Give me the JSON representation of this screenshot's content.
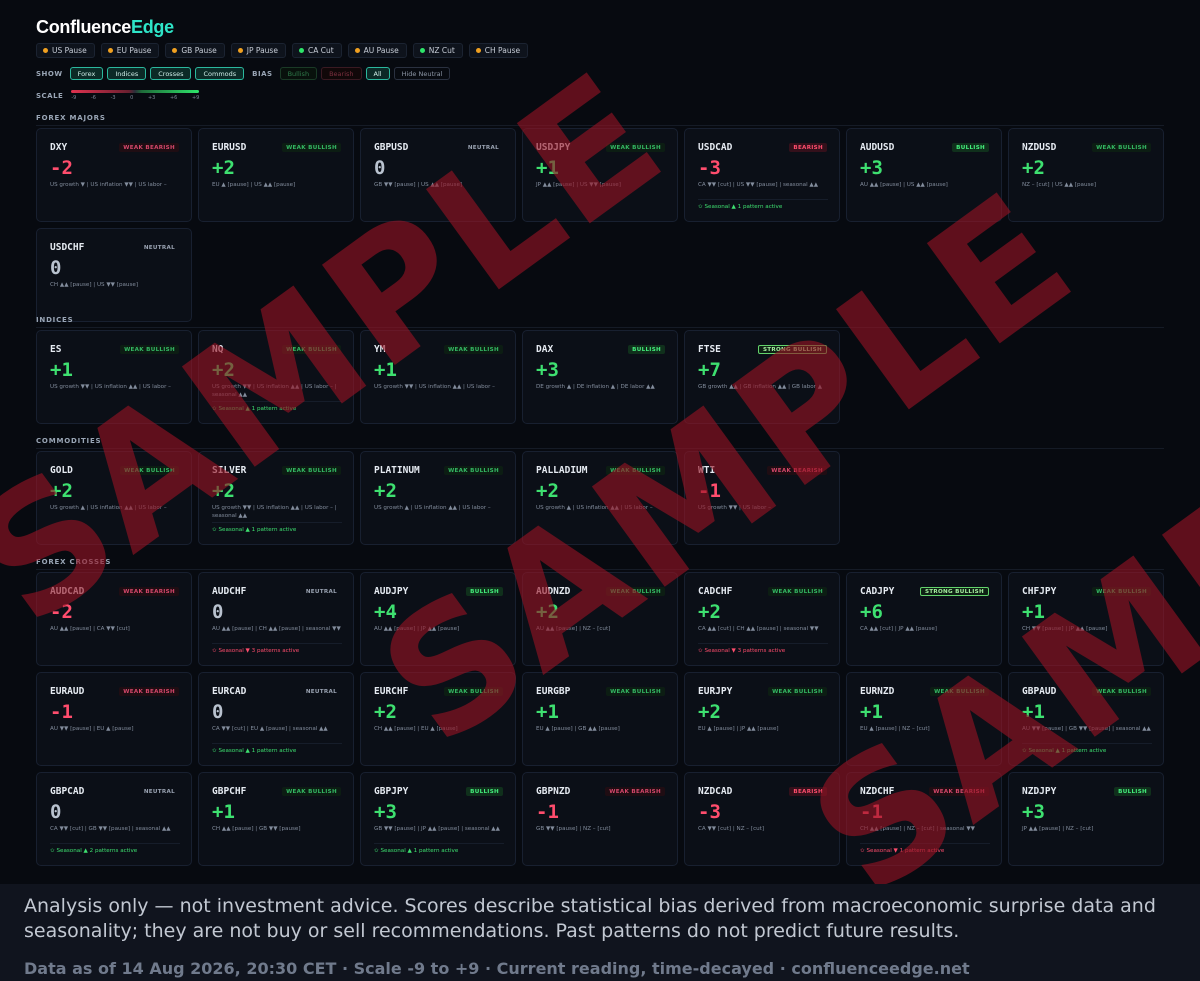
{
  "brand": {
    "part1": "Confluence",
    "part2": "Edge"
  },
  "sessions": [
    {
      "label": "US Pause",
      "color": "#f0a020"
    },
    {
      "label": "EU Pause",
      "color": "#f0a020"
    },
    {
      "label": "GB Pause",
      "color": "#f0a020"
    },
    {
      "label": "JP Pause",
      "color": "#f0a020"
    },
    {
      "label": "CA Cut",
      "color": "#2ee56a"
    },
    {
      "label": "AU Pause",
      "color": "#f0a020"
    },
    {
      "label": "NZ Cut",
      "color": "#2ee56a"
    },
    {
      "label": "CH Pause",
      "color": "#f0a020"
    }
  ],
  "filters": {
    "show_label": "SHOW",
    "show_chips": [
      "Forex",
      "Indices",
      "Crosses",
      "Commods"
    ],
    "bias_label": "BIAS",
    "bias_chips": [
      {
        "label": "Bullish",
        "style": "bull"
      },
      {
        "label": "Bearish",
        "style": "bear"
      },
      {
        "label": "All",
        "style": "on"
      },
      {
        "label": "Hide Neutral",
        "style": "neutral"
      }
    ]
  },
  "scale": {
    "label": "SCALE",
    "ticks": [
      "-9",
      "-6",
      "-3",
      "0",
      "+3",
      "+6",
      "+9"
    ]
  },
  "sections": [
    {
      "title": "FOREX MAJORS",
      "cards": [
        {
          "symbol": "DXY",
          "badge": "WEAK BEARISH",
          "badge_style": "wbear",
          "score": "-2",
          "drivers": "US growth ▼ | US inflation ▼▼ | US labor –"
        },
        {
          "symbol": "EURUSD",
          "badge": "WEAK BULLISH",
          "badge_style": "wbull",
          "score": "+2",
          "drivers": "EU ▲ [pause] | US ▲▲ [pause]"
        },
        {
          "symbol": "GBPUSD",
          "badge": "NEUTRAL",
          "badge_style": "neutral",
          "score": "0",
          "drivers": "GB ▼▼ [pause] | US ▲▲ [pause]"
        },
        {
          "symbol": "USDJPY",
          "badge": "WEAK BULLISH",
          "badge_style": "wbull",
          "score": "+1",
          "drivers": "JP ▲▲ [pause] | US ▼▼ [pause]"
        },
        {
          "symbol": "USDCAD",
          "badge": "BEARISH",
          "badge_style": "bear",
          "score": "-3",
          "drivers": "CA ▼▼ [cut] | US ▼▼ [pause] | seasonal ▲▲",
          "seasonal": "✩ Seasonal ▲ 1 pattern active",
          "seasonal_dir": "up"
        },
        {
          "symbol": "AUDUSD",
          "badge": "BULLISH",
          "badge_style": "bull",
          "score": "+3",
          "drivers": "AU ▲▲ [pause] | US ▲▲ [pause]"
        },
        {
          "symbol": "NZDUSD",
          "badge": "WEAK BULLISH",
          "badge_style": "wbull",
          "score": "+2",
          "drivers": "NZ – [cut] | US ▲▲ [pause]"
        },
        {
          "symbol": "USDCHF",
          "badge": "NEUTRAL",
          "badge_style": "neutral",
          "score": "0",
          "drivers": "CH ▲▲ [pause] | US ▼▼ [pause]"
        }
      ]
    },
    {
      "title": "INDICES",
      "cards": [
        {
          "symbol": "ES",
          "badge": "WEAK BULLISH",
          "badge_style": "wbull",
          "score": "+1",
          "drivers": "US growth ▼▼ | US inflation ▲▲ | US labor –"
        },
        {
          "symbol": "NQ",
          "badge": "WEAK BULLISH",
          "badge_style": "wbull",
          "score": "+2",
          "drivers": "US growth ▼▼ | US inflation ▲▲ | US labor – | seasonal ▲▲",
          "seasonal": "✩ Seasonal ▲ 1 pattern active",
          "seasonal_dir": "up"
        },
        {
          "symbol": "YM",
          "badge": "WEAK BULLISH",
          "badge_style": "wbull",
          "score": "+1",
          "drivers": "US growth ▼▼ | US inflation ▲▲ | US labor –"
        },
        {
          "symbol": "DAX",
          "badge": "BULLISH",
          "badge_style": "bull",
          "score": "+3",
          "drivers": "DE growth ▲ | DE inflation ▲ | DE labor ▲▲"
        },
        {
          "symbol": "FTSE",
          "badge": "STRONG BULLISH",
          "badge_style": "sbull",
          "score": "+7",
          "drivers": "GB growth ▲▲ | GB inflation ▲▲ | GB labor ▲"
        }
      ]
    },
    {
      "title": "COMMODITIES",
      "cards": [
        {
          "symbol": "GOLD",
          "badge": "WEAK BULLISH",
          "badge_style": "wbull",
          "score": "+2",
          "drivers": "US growth ▲ | US inflation ▲▲ | US labor –"
        },
        {
          "symbol": "SILVER",
          "badge": "WEAK BULLISH",
          "badge_style": "wbull",
          "score": "+2",
          "drivers": "US growth ▼▼ | US inflation ▲▲ | US labor – | seasonal ▲▲",
          "seasonal": "✩ Seasonal ▲ 1 pattern active",
          "seasonal_dir": "up"
        },
        {
          "symbol": "PLATINUM",
          "badge": "WEAK BULLISH",
          "badge_style": "wbull",
          "score": "+2",
          "drivers": "US growth ▲ | US inflation ▲▲ | US labor –"
        },
        {
          "symbol": "PALLADIUM",
          "badge": "WEAK BULLISH",
          "badge_style": "wbull",
          "score": "+2",
          "drivers": "US growth ▲ | US inflation ▲▲ | US labor –"
        },
        {
          "symbol": "WTI",
          "badge": "WEAK BEARISH",
          "badge_style": "wbear",
          "score": "-1",
          "drivers": "US growth ▼▼ | US labor –"
        }
      ]
    },
    {
      "title": "FOREX CROSSES",
      "cards": [
        {
          "symbol": "AUDCAD",
          "badge": "WEAK BEARISH",
          "badge_style": "wbear",
          "score": "-2",
          "drivers": "AU ▲▲ [pause] | CA ▼▼ [cut]"
        },
        {
          "symbol": "AUDCHF",
          "badge": "NEUTRAL",
          "badge_style": "neutral",
          "score": "0",
          "drivers": "AU ▲▲ [pause] | CH ▲▲ [pause] | seasonal ▼▼",
          "seasonal": "✩ Seasonal ▼ 3 patterns active",
          "seasonal_dir": "down"
        },
        {
          "symbol": "AUDJPY",
          "badge": "BULLISH",
          "badge_style": "bull",
          "score": "+4",
          "drivers": "AU ▲▲ [pause] | JP ▲▲ [pause]"
        },
        {
          "symbol": "AUDNZD",
          "badge": "WEAK BULLISH",
          "badge_style": "wbull",
          "score": "+2",
          "drivers": "AU ▲▲ [pause] | NZ – [cut]"
        },
        {
          "symbol": "CADCHF",
          "badge": "WEAK BULLISH",
          "badge_style": "wbull",
          "score": "+2",
          "drivers": "CA ▲▲ [cut] | CH ▲▲ [pause] | seasonal ▼▼",
          "seasonal": "✩ Seasonal ▼ 3 patterns active",
          "seasonal_dir": "down"
        },
        {
          "symbol": "CADJPY",
          "badge": "STRONG BULLISH",
          "badge_style": "sbull",
          "score": "+6",
          "drivers": "CA ▲▲ [cut] | JP ▲▲ [pause]"
        },
        {
          "symbol": "CHFJPY",
          "badge": "WEAK BULLISH",
          "badge_style": "wbull",
          "score": "+1",
          "drivers": "CH ▼▼ [pause] | JP ▲▲ [pause]"
        },
        {
          "symbol": "EURAUD",
          "badge": "WEAK BEARISH",
          "badge_style": "wbear",
          "score": "-1",
          "drivers": "AU ▼▼ [pause] | EU ▲ [pause]"
        },
        {
          "symbol": "EURCAD",
          "badge": "NEUTRAL",
          "badge_style": "neutral",
          "score": "0",
          "drivers": "CA ▼▼ [cut] | EU ▲ [pause] | seasonal ▲▲",
          "seasonal": "✩ Seasonal ▲ 1 pattern active",
          "seasonal_dir": "up"
        },
        {
          "symbol": "EURCHF",
          "badge": "WEAK BULLISH",
          "badge_style": "wbull",
          "score": "+2",
          "drivers": "CH ▲▲ [pause] | EU ▲ [pause]"
        },
        {
          "symbol": "EURGBP",
          "badge": "WEAK BULLISH",
          "badge_style": "wbull",
          "score": "+1",
          "drivers": "EU ▲ [pause] | GB ▲▲ [pause]"
        },
        {
          "symbol": "EURJPY",
          "badge": "WEAK BULLISH",
          "badge_style": "wbull",
          "score": "+2",
          "drivers": "EU ▲ [pause] | JP ▲▲ [pause]"
        },
        {
          "symbol": "EURNZD",
          "badge": "WEAK BULLISH",
          "badge_style": "wbull",
          "score": "+1",
          "drivers": "EU ▲ [pause] | NZ – [cut]"
        },
        {
          "symbol": "GBPAUD",
          "badge": "WEAK BULLISH",
          "badge_style": "wbull",
          "score": "+1",
          "drivers": "AU ▼▼ [pause] | GB ▼▼ [pause] | seasonal ▲▲",
          "seasonal": "✩ Seasonal ▲ 1 pattern active",
          "seasonal_dir": "up"
        },
        {
          "symbol": "GBPCAD",
          "badge": "NEUTRAL",
          "badge_style": "neutral",
          "score": "0",
          "drivers": "CA ▼▼ [cut] | GB ▼▼ [pause] | seasonal ▲▲",
          "seasonal": "✩ Seasonal ▲ 2 patterns active",
          "seasonal_dir": "up"
        },
        {
          "symbol": "GBPCHF",
          "badge": "WEAK BULLISH",
          "badge_style": "wbull",
          "score": "+1",
          "drivers": "CH ▲▲ [pause] | GB ▼▼ [pause]"
        },
        {
          "symbol": "GBPJPY",
          "badge": "BULLISH",
          "badge_style": "bull",
          "score": "+3",
          "drivers": "GB ▼▼ [pause] | JP ▲▲ [pause] | seasonal ▲▲",
          "seasonal": "✩ Seasonal ▲ 1 pattern active",
          "seasonal_dir": "up"
        },
        {
          "symbol": "GBPNZD",
          "badge": "WEAK BEARISH",
          "badge_style": "wbear",
          "score": "-1",
          "drivers": "GB ▼▼ [pause] | NZ – [cut]"
        },
        {
          "symbol": "NZDCAD",
          "badge": "BEARISH",
          "badge_style": "bear",
          "score": "-3",
          "drivers": "CA ▼▼ [cut] | NZ – [cut]"
        },
        {
          "symbol": "NZDCHF",
          "badge": "WEAK BEARISH",
          "badge_style": "wbear",
          "score": "-1",
          "drivers": "CH ▲▲ [pause] | NZ – [cut] | seasonal ▼▼",
          "seasonal": "✩ Seasonal ▼ 1 pattern active",
          "seasonal_dir": "down"
        },
        {
          "symbol": "NZDJPY",
          "badge": "BULLISH",
          "badge_style": "bull",
          "score": "+3",
          "drivers": "JP ▲▲ [pause] | NZ – [cut]"
        }
      ]
    }
  ],
  "watermark": [
    "SAMPLE",
    "SAMPLE",
    "SAMPLE"
  ],
  "footer": {
    "disclaimer": "Analysis only — not investment advice. Scores describe statistical bias derived from macroeconomic surprise data and seasonality; they are not buy or sell recommendations. Past patterns do not predict future results.",
    "meta": "Data as of 14 Aug 2026, 20:30 CET · Scale -9 to +9 · Current reading, time-decayed · confluenceedge.net"
  }
}
